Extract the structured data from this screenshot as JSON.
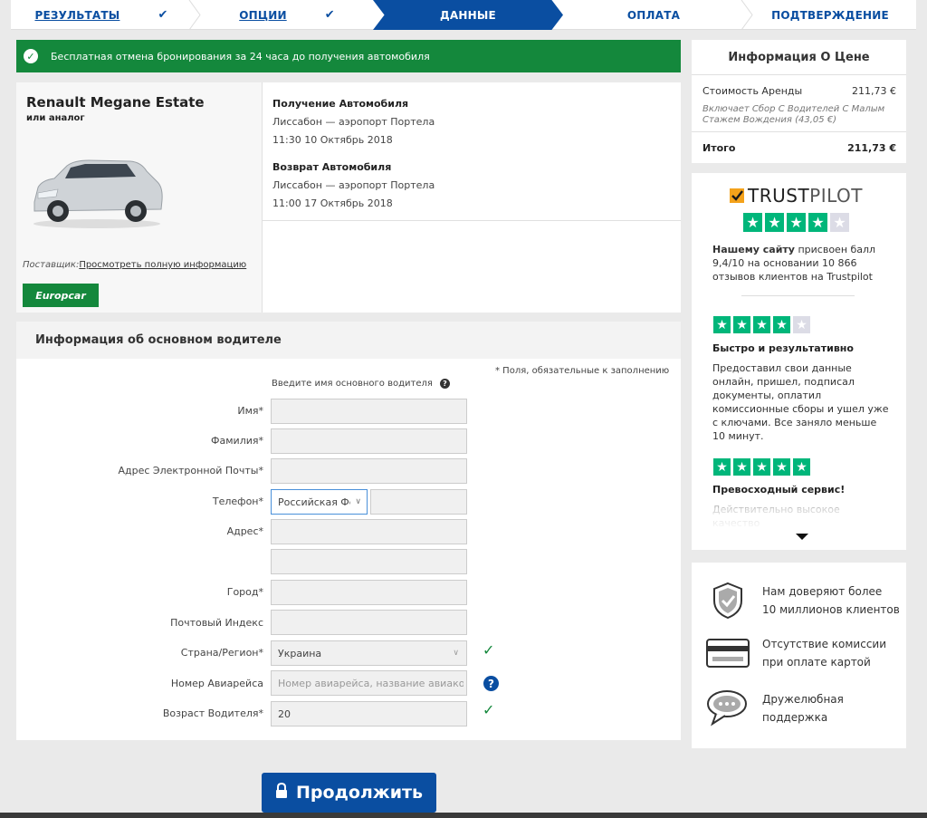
{
  "steps": [
    {
      "label": "РЕЗУЛЬТАТЫ",
      "done": true
    },
    {
      "label": "ОПЦИИ",
      "done": true
    },
    {
      "label": "ДАННЫЕ",
      "active": true
    },
    {
      "label": "ОПЛАТА"
    },
    {
      "label": "ПОДТВЕРЖДЕНИЕ"
    }
  ],
  "banner": {
    "text": "Бесплатная отмена бронирования за 24 часа до получения автомобиля"
  },
  "car": {
    "name": "Renault Megane Estate",
    "subtitle": "или аналог",
    "supplier_label": "Поставщик:",
    "supplier_link": "Просмотреть полную информацию",
    "supplier_logo": "Europcar"
  },
  "pickup": {
    "heading": "Получение Автомобиля",
    "location": "Лиссабон — аэропорт Портела",
    "datetime": "11:30 10 Октябрь 2018"
  },
  "dropoff": {
    "heading": "Возврат Автомобиля",
    "location": "Лиссабон — аэропорт Портела",
    "datetime": "11:00 17 Октябрь 2018"
  },
  "driver": {
    "title": "Информация об основном водителе",
    "required_note": "* Поля, обязательные к заполнению",
    "hint": "Введите имя основного водителя",
    "fields": {
      "first_name": "Имя*",
      "last_name": "Фамилия*",
      "email": "Адрес Электронной Почты*",
      "phone": "Телефон*",
      "phone_country": "Российская Фе",
      "address": "Адрес*",
      "city": "Город*",
      "postcode": "Почтовый Индекс",
      "country": "Страна/Регион*",
      "country_value": "Украина",
      "flight": "Номер Авиарейса",
      "flight_placeholder": "Номер авиарейса, название авиаком",
      "age": "Возраст Водителя*",
      "age_value": "20"
    }
  },
  "price": {
    "title": "Информация О Цене",
    "rental_label": "Стоимость Аренды",
    "rental_value": "211,73 €",
    "note": "Включает Сбор С Водителей С Малым Стажем Вождения (43,05 €)",
    "total_label": "Итого",
    "total_value": "211,73 €"
  },
  "trustpilot": {
    "brand_a": "TRUST",
    "brand_b": "PILOT",
    "rating_stars": 4,
    "summary_bold": "Нашему сайту",
    "summary_rest": " присвоен балл 9,4/10 на основании 10 866 отзывов клиентов на Trustpilot",
    "reviews": [
      {
        "stars": 4,
        "heading": "Быстро и результативно",
        "text": "Предоставил свои данные онлайн, пришел, подписал документы, оплатил комиссионные сборы и ушел уже с ключами. Все заняло меньше 10 минут."
      },
      {
        "stars": 5,
        "heading": "Превосходный сервис!",
        "text": "Действительно высокое качество"
      }
    ]
  },
  "trust": [
    {
      "icon": "shield-check-icon",
      "line1": "Нам доверяют более",
      "line2": "10 миллионов клиентов"
    },
    {
      "icon": "credit-card-icon",
      "line1": "Отсутствие комиссии",
      "line2": "при оплате картой"
    },
    {
      "icon": "chat-bubble-icon",
      "line1": "Дружелюбная",
      "line2": "поддержка"
    }
  ],
  "continue_label": "Продолжить",
  "colors": {
    "brand": "#0a4ea1",
    "success": "#14883c",
    "trustpilot": "#00b67a"
  }
}
